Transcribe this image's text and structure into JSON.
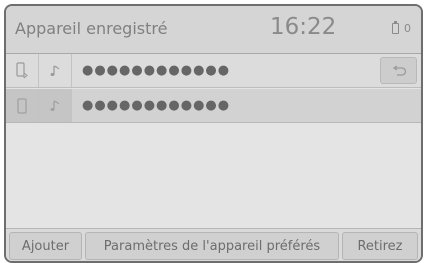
{
  "header": {
    "title": "Appareil enregistré",
    "time": "16:22",
    "status_value": "0"
  },
  "devices": [
    {
      "name": "●●●●●●●●●●●●",
      "device_icon": "phone-bluetooth-icon",
      "audio_icon": "music-note-icon",
      "selected": false
    },
    {
      "name": "●●●●●●●●●●●●",
      "device_icon": "phone-icon",
      "audio_icon": "music-note-icon",
      "selected": true
    }
  ],
  "back_icon": "back-arrow-icon",
  "footer": {
    "add_label": "Ajouter",
    "preferred_label": "Paramètres de l'appareil préférés",
    "remove_label": "Retirez"
  }
}
